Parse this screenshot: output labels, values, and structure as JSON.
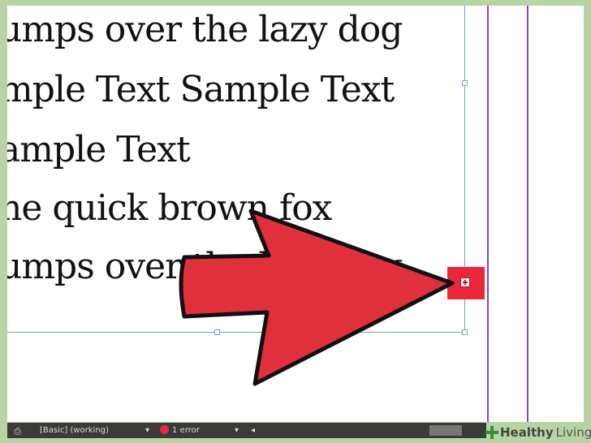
{
  "document": {
    "lines": [
      "umps over the lazy dog",
      "mple Text Sample Text",
      "ample Text",
      "ne quick brown fox",
      "umps over the lazy dog"
    ]
  },
  "status_bar": {
    "preflight_profile": "[Basic] (working)",
    "error_count": "1 error",
    "menu_arrow_icon": "triangle-down",
    "error_status_color": "#e8283a"
  },
  "overflow_indicator": {
    "icon": "plus-in-box",
    "color": "#e8283a"
  },
  "callout_arrow": {
    "color": "#e0303c"
  },
  "watermark": {
    "brand": "Healthy",
    "word": "Living"
  }
}
